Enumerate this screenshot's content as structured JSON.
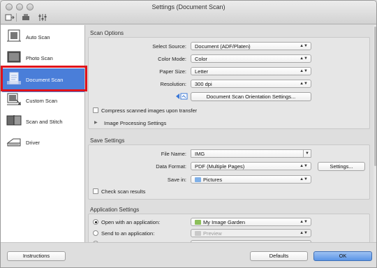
{
  "window": {
    "title": "Settings (Document Scan)"
  },
  "sidebar": {
    "items": [
      {
        "label": "Auto Scan",
        "icon": "auto-scan-icon"
      },
      {
        "label": "Photo Scan",
        "icon": "photo-scan-icon"
      },
      {
        "label": "Document Scan",
        "icon": "document-scan-icon",
        "selected": true
      },
      {
        "label": "Custom Scan",
        "icon": "custom-scan-icon"
      },
      {
        "label": "Scan and Stitch",
        "icon": "scan-stitch-icon"
      },
      {
        "label": "Driver",
        "icon": "driver-icon"
      }
    ]
  },
  "scan_options": {
    "heading": "Scan Options",
    "select_source_label": "Select Source:",
    "select_source_value": "Document (ADF/Platen)",
    "color_mode_label": "Color Mode:",
    "color_mode_value": "Color",
    "paper_size_label": "Paper Size:",
    "paper_size_value": "Letter",
    "resolution_label": "Resolution:",
    "resolution_value": "300 dpi",
    "orientation_button": "Document Scan Orientation Settings...",
    "compress_label": "Compress scanned images upon transfer",
    "image_processing_label": "Image Processing Settings"
  },
  "save_settings": {
    "heading": "Save Settings",
    "file_name_label": "File Name:",
    "file_name_value": "IMG",
    "data_format_label": "Data Format:",
    "data_format_value": "PDF (Multiple Pages)",
    "settings_button": "Settings...",
    "save_in_label": "Save in:",
    "save_in_value": "Pictures",
    "check_results_label": "Check scan results"
  },
  "app_settings": {
    "heading": "Application Settings",
    "open_with_label": "Open with an application:",
    "open_with_value": "My Image Garden",
    "send_to_label": "Send to an application:",
    "send_to_value": "Preview"
  },
  "footer": {
    "instructions_button": "Instructions",
    "defaults_button": "Defaults",
    "ok_button": "OK"
  },
  "colors": {
    "selection": "#4a7ed9",
    "highlight_border": "#e0121b",
    "ok_button": "#5b95e6"
  }
}
